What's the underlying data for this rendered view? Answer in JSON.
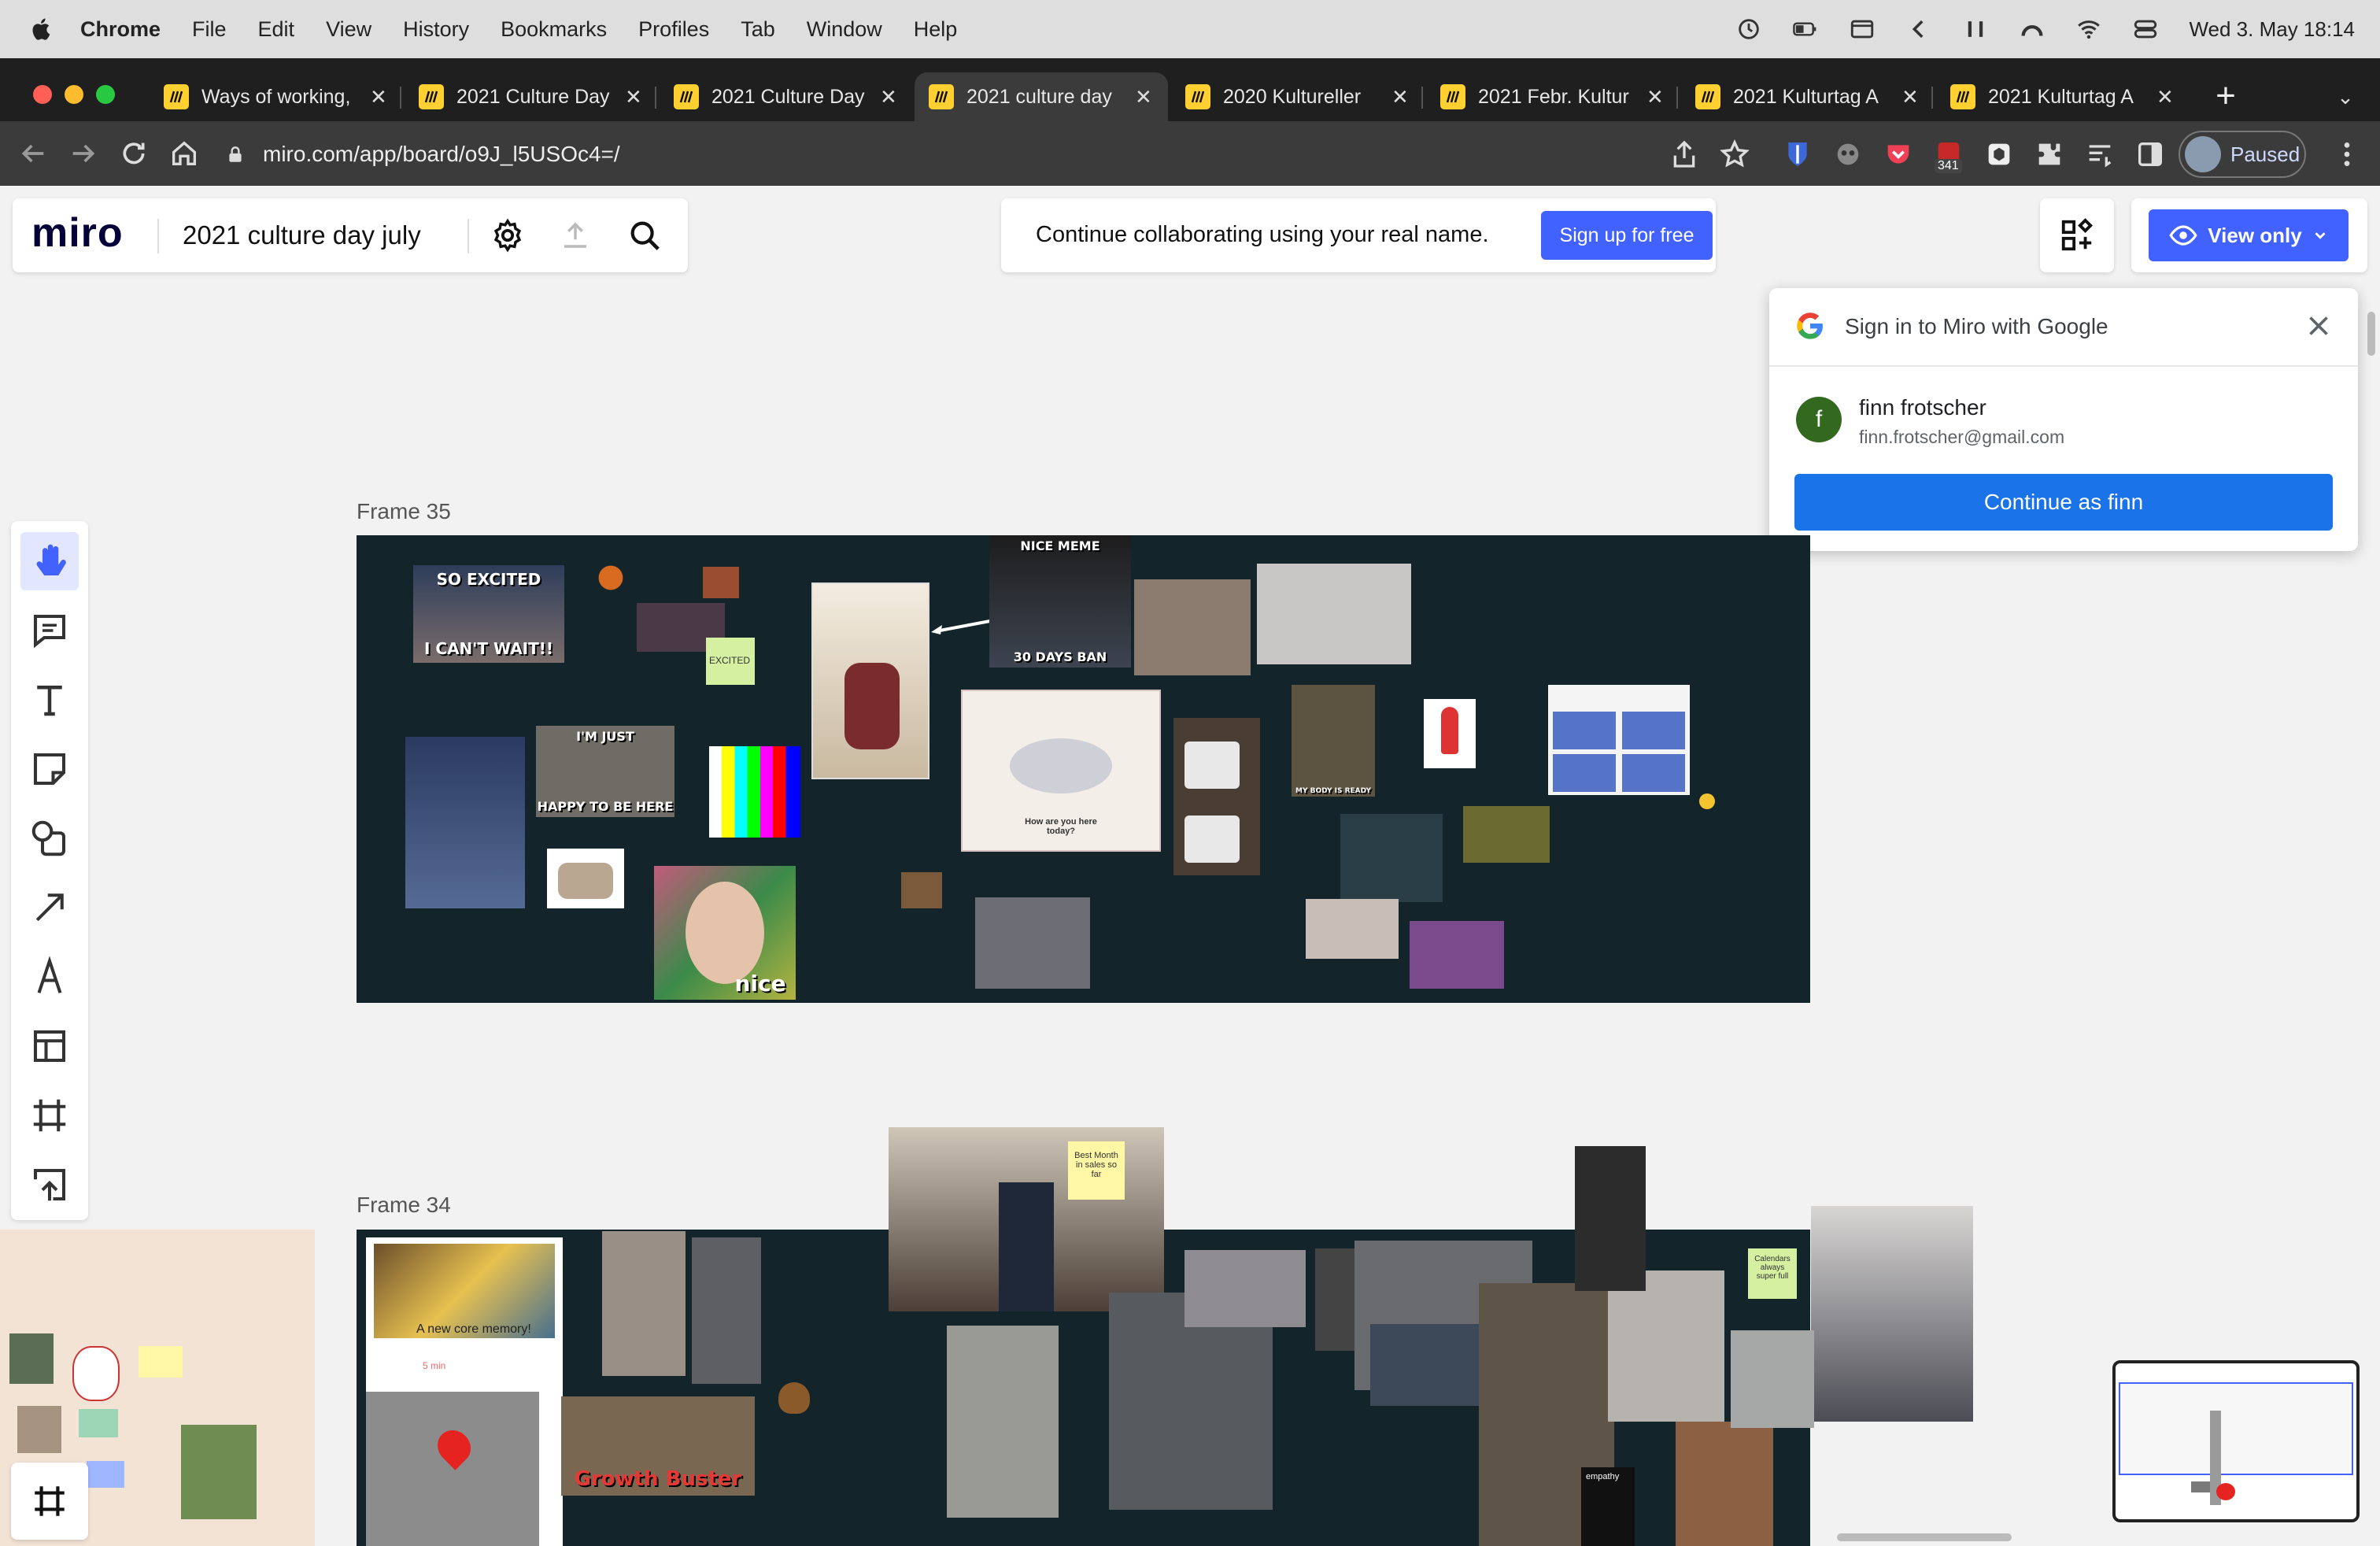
{
  "menubar": {
    "app": "Chrome",
    "items": [
      "File",
      "Edit",
      "View",
      "History",
      "Bookmarks",
      "Profiles",
      "Tab",
      "Window",
      "Help"
    ],
    "datetime": "Wed 3. May  18:14"
  },
  "tabs": [
    {
      "title": "Ways of working,"
    },
    {
      "title": "2021 Culture Day"
    },
    {
      "title": "2021 Culture Day"
    },
    {
      "title": "2021 culture day"
    },
    {
      "title": "2020 Kultureller"
    },
    {
      "title": "2021 Febr. Kultur"
    },
    {
      "title": "2021 Kulturtag A"
    },
    {
      "title": "2021 Kulturtag A"
    }
  ],
  "address": {
    "url": "miro.com/app/board/o9J_l5USOc4=/"
  },
  "profile": {
    "label": "Paused"
  },
  "extension_badge": "341",
  "miro": {
    "logo": "miro",
    "board_name": "2021 culture day july",
    "banner_text": "Continue collaborating using your real name.",
    "signup_label": "Sign up for free",
    "view_only_label": "View only"
  },
  "google_popup": {
    "title": "Sign in to Miro with Google",
    "user_name": "finn frotscher",
    "user_email": "finn.frotscher@gmail.com",
    "avatar_letter": "f",
    "continue_label": "Continue as finn"
  },
  "frames": {
    "frame35_label": "Frame 35",
    "frame34_label": "Frame 34"
  },
  "memes": {
    "so_excited_top": "SO EXCITED",
    "so_excited_bottom": "I CAN'T WAIT!!",
    "excited_note": "EXCITED",
    "nice_meme": "NICE MEME",
    "thirty_days_ban": "30 DAYS BAN",
    "im_just": "I'M JUST",
    "happy_to_be_here": "HAPPY TO BE HERE",
    "nice": "nice",
    "how_are_you": "How are you here today?",
    "body_ready": "MY BODY IS READY",
    "best_month_note": "Best Month in sales so far",
    "new_core_memory": "A new core memory!",
    "growth_buster": "Growth Buster",
    "calendars_note": "Calendars always super full",
    "empathy": "empathy",
    "core_min": "5 min"
  },
  "colors": {
    "miro_blue": "#4262ff",
    "google_blue": "#1a73e8",
    "frame_bg": "#14242b"
  }
}
